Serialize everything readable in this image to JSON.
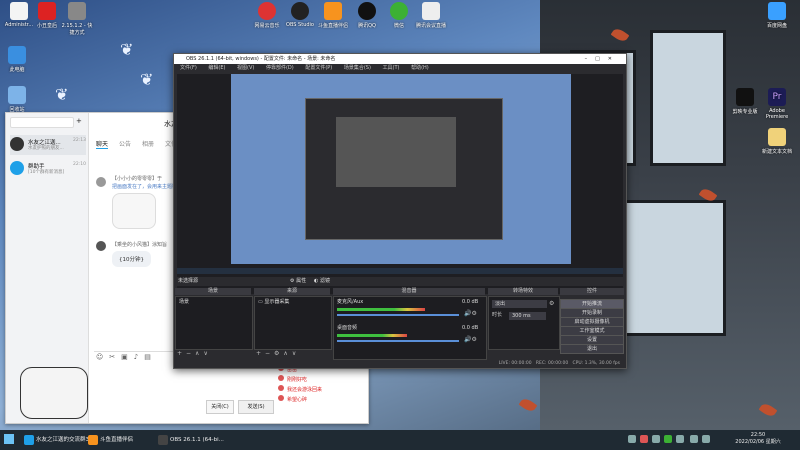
{
  "desktop": {
    "top_icons": [
      {
        "label": "Administr...",
        "color": "#ffffff"
      },
      {
        "label": "小丑皇后",
        "color": "#d22"
      },
      {
        "label": "2.15.1.2 - 快捷方式",
        "color": "#333"
      },
      {
        "label": "网易云音乐",
        "color": "#d33"
      },
      {
        "label": "OBS Studio",
        "color": "#222"
      },
      {
        "label": "斗鱼直播伴侣",
        "color": "#f7931e"
      },
      {
        "label": "腾讯QQ",
        "color": "#111"
      },
      {
        "label": "微信",
        "color": "#3cb034"
      },
      {
        "label": "腾讯会议直播",
        "color": "#eee"
      }
    ],
    "left_icons": [
      {
        "label": "此电脑",
        "color": "#3a8fe0"
      },
      {
        "label": "回收站",
        "color": "#7db3e8"
      }
    ],
    "right_icons": [
      {
        "label": "百度网盘",
        "color": "#3aa0ff"
      },
      {
        "label": "剪映专业版",
        "color": "#111"
      },
      {
        "label": "Adobe Premiere",
        "color": "#1c1c55"
      },
      {
        "label": "新建文本文档",
        "color": "#f0d27a"
      }
    ]
  },
  "chat": {
    "contacts": [
      {
        "name": "水友之江迦...",
        "sub": "水友护照的朋友...",
        "time": "22:13",
        "color": "#333"
      },
      {
        "name": "群助手",
        "sub": "[10个群有新消息]",
        "time": "22:10",
        "color": "#1fa0e8"
      }
    ],
    "window_title": "水友",
    "tabs": [
      "聊天",
      "公告",
      "相册",
      "文件"
    ],
    "messages": [
      {
        "name": "【小小小的零零零】于",
        "text": "把画面发在了，会用来主题链接"
      },
      {
        "name": "【乘坐的小风猫】涂知旨",
        "text": ""
      }
    ],
    "bubble": "{10分钟}",
    "close_btn": "关闭(C)",
    "send_btn": "发送(S)",
    "members": [
      "苗苗",
      "刚刚好吃",
      "我还会游泳回来",
      "希望心碎"
    ]
  },
  "obs": {
    "title": "OBS 26.1.1 (64-bit, windows) - 配置文件: 未命名 - 场景: 未命名",
    "menu": [
      "文件(F)",
      "编辑(E)",
      "视图(V)",
      "停靠部件(D)",
      "配置文件(P)",
      "场景集合(S)",
      "工具(T)",
      "帮助(H)"
    ],
    "no_source": "未选择源",
    "props_btn": "属性",
    "filters_btn": "滤镜",
    "scenes_hdr": "场景",
    "scene_items": [
      "场景"
    ],
    "sources_hdr": "来源",
    "source_items": [
      "显示器采集"
    ],
    "mixer_hdr": "混音器",
    "mixer_tracks": [
      {
        "name": "麦克风/Aux",
        "db": "0.0 dB",
        "level": 0.62
      },
      {
        "name": "桌面音频",
        "db": "0.0 dB",
        "level": 0.48
      }
    ],
    "transition_hdr": "转场特效",
    "transition_value": "淡出",
    "duration_label": "时长",
    "duration_value": "300 ms",
    "controls_hdr": "控件",
    "controls": [
      "开始推流",
      "开始录制",
      "启动虚拟摄像机",
      "工作室模式",
      "设置",
      "退出"
    ],
    "status": {
      "live": "LIVE: 00:00:00",
      "rec": "REC: 00:00:00",
      "cpu": "CPU: 1.3%, 30.00 fps"
    }
  },
  "taskbar": {
    "items": [
      {
        "label": "水友之江迦的交流群3...",
        "color": "#1fa0e8"
      },
      {
        "label": "斗鱼直播伴侣",
        "color": "#f7931e"
      },
      {
        "label": "OBS 26.1.1 (64-bi...",
        "color": "#333"
      }
    ],
    "time": "22:50",
    "date": "2022/02/06 星期六"
  }
}
